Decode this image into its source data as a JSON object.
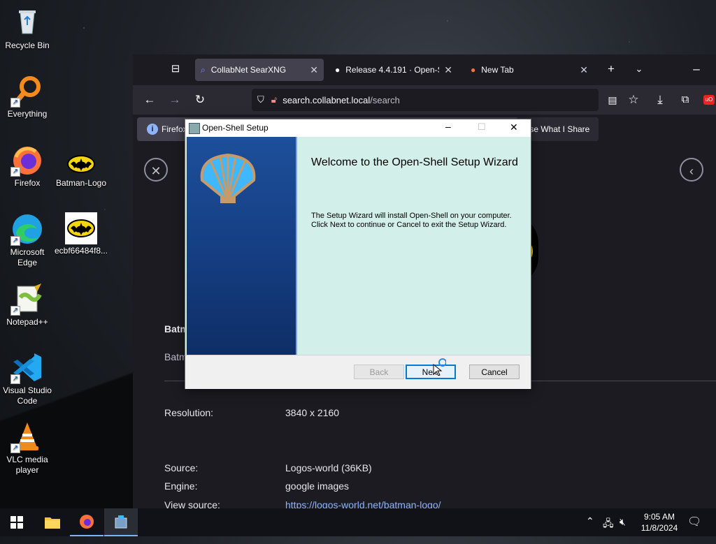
{
  "desktop": {
    "icons": [
      {
        "label": "Recycle Bin"
      },
      {
        "label": "Everything"
      },
      {
        "label": "Firefox"
      },
      {
        "label": "Batman-Logo"
      },
      {
        "label": "Microsoft Edge"
      },
      {
        "label": "ecbf66484f8..."
      },
      {
        "label": "Notepad++"
      },
      {
        "label": "Visual Studio Code"
      },
      {
        "label": "VLC media player"
      }
    ]
  },
  "browser": {
    "tabs": [
      {
        "label": "CollabNet SearXNG",
        "active": true
      },
      {
        "label": "Release 4.4.191 · Open-Sh"
      },
      {
        "label": "New Tab"
      }
    ],
    "url_host": "search.collabnet.local",
    "url_path": "/search",
    "infobar": {
      "text": "Firefox",
      "button": "ose What I Share"
    },
    "content": {
      "title_partial": "Batm",
      "subtitle_partial": "Batm",
      "resolution_label": "Resolution:",
      "resolution_value": "3840 x 2160",
      "source_label": "Source:",
      "source_value": "Logos-world (36KB)",
      "engine_label": "Engine:",
      "engine_value": "google images",
      "viewsource_label": "View source:",
      "viewsource_value": "https://logos-world.net/batman-logo/"
    }
  },
  "dialog": {
    "title": "Open-Shell Setup",
    "heading": "Welcome to the Open-Shell Setup Wizard",
    "body_line1": "The Setup Wizard will install Open-Shell on your computer.",
    "body_line2": "Click Next to continue or Cancel to exit the Setup Wizard.",
    "back": "Back",
    "next": "Next",
    "cancel": "Cancel"
  },
  "taskbar": {
    "time": "9:05 AM",
    "date": "11/8/2024"
  },
  "colors": {
    "accent": "#0078d7",
    "link": "#8cb4ff",
    "dialog_bg": "#d3efe9"
  }
}
